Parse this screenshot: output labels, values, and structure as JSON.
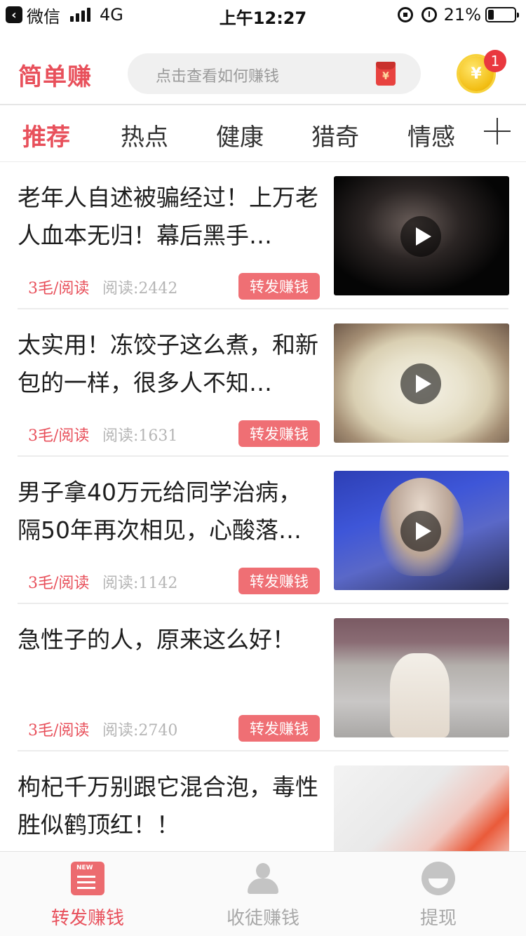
{
  "status_bar": {
    "back_app": "微信",
    "network": "4G",
    "time": "上午12:27",
    "battery": "21%",
    "battery_level": 0.21
  },
  "header": {
    "logo": "简单赚",
    "search_placeholder": "点击查看如何赚钱",
    "redpacket_symbol": "¥",
    "coin_symbol": "¥",
    "coin_badge": "1"
  },
  "tabs": [
    {
      "label": "推荐",
      "active": true
    },
    {
      "label": "热点",
      "active": false
    },
    {
      "label": "健康",
      "active": false
    },
    {
      "label": "猎奇",
      "active": false
    },
    {
      "label": "情感",
      "active": false
    }
  ],
  "feed": {
    "items": [
      {
        "title": "老年人自述被骗经过！上万老人血本无归！幕后黑手…",
        "price": "3毛/阅读",
        "reads": "阅读:2442",
        "button": "转发赚钱",
        "video": true
      },
      {
        "title": "太实用！冻饺子这么煮，和新包的一样，很多人不知…",
        "price": "3毛/阅读",
        "reads": "阅读:1631",
        "button": "转发赚钱",
        "video": true
      },
      {
        "title": "男子拿40万元给同学治病，隔50年再次相见，心酸落…",
        "price": "3毛/阅读",
        "reads": "阅读:1142",
        "button": "转发赚钱",
        "video": true
      },
      {
        "title": "急性子的人，原来这么好！",
        "price": "3毛/阅读",
        "reads": "阅读:2740",
        "button": "转发赚钱",
        "video": false
      },
      {
        "title": "枸杞千万别跟它混合泡，毒性胜似鹤顶红！！",
        "price": "",
        "reads": "",
        "button": "",
        "video": false
      }
    ]
  },
  "bottom_nav": [
    {
      "label": "转发赚钱",
      "icon": "news-icon",
      "active": true
    },
    {
      "label": "收徒赚钱",
      "icon": "user-icon",
      "active": false
    },
    {
      "label": "提现",
      "icon": "withdraw-icon",
      "active": false
    }
  ],
  "colors": {
    "accent": "#e8505b",
    "share_button": "#ef6f74",
    "inactive": "#a8a8a8"
  }
}
